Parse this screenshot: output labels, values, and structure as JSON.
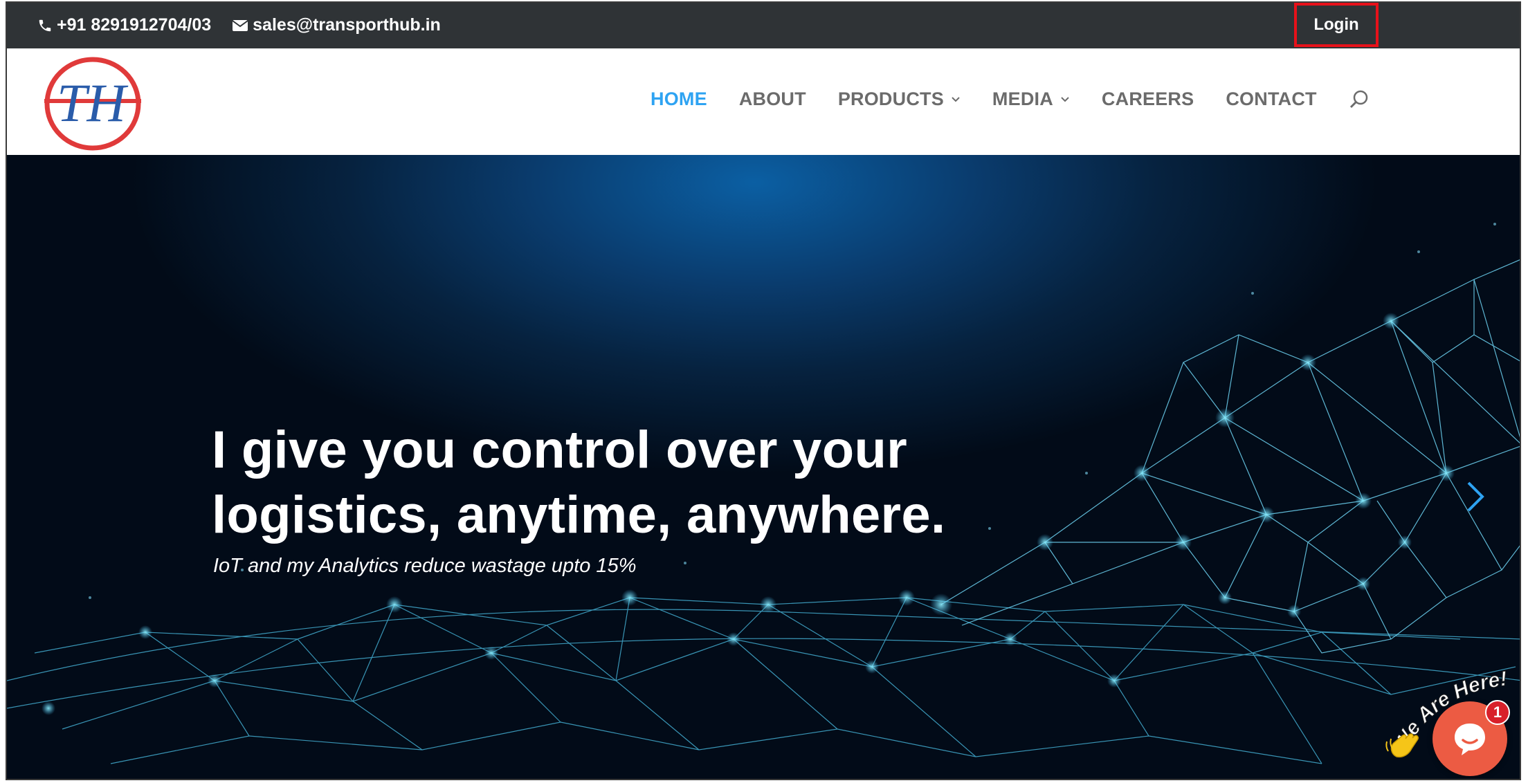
{
  "topbar": {
    "phone": "+91 8291912704/03",
    "email": "sales@transporthub.in",
    "login_label": "Login",
    "phone_icon": "phone-icon",
    "email_icon": "envelope-icon"
  },
  "logo": {
    "text": "TH",
    "ring_color": "#e03a3a",
    "letter_color": "#2a5caa"
  },
  "nav": {
    "items": [
      {
        "label": "HOME",
        "active": true
      },
      {
        "label": "ABOUT"
      },
      {
        "label": "PRODUCTS",
        "has_dropdown": true
      },
      {
        "label": "MEDIA",
        "has_dropdown": true
      },
      {
        "label": "CAREERS"
      },
      {
        "label": "CONTACT"
      }
    ],
    "search_icon": "search-icon",
    "active_color": "#2ea3f2"
  },
  "hero": {
    "headline_line1": "I give you control over your",
    "headline_line2": "logistics, anytime, anywhere.",
    "subline": "IoT and my Analytics reduce wastage upto 15%",
    "next_icon": "chevron-right-icon"
  },
  "chat": {
    "banner": "We Are Here!",
    "unread_count": "1",
    "button_color": "#ec5b43"
  }
}
